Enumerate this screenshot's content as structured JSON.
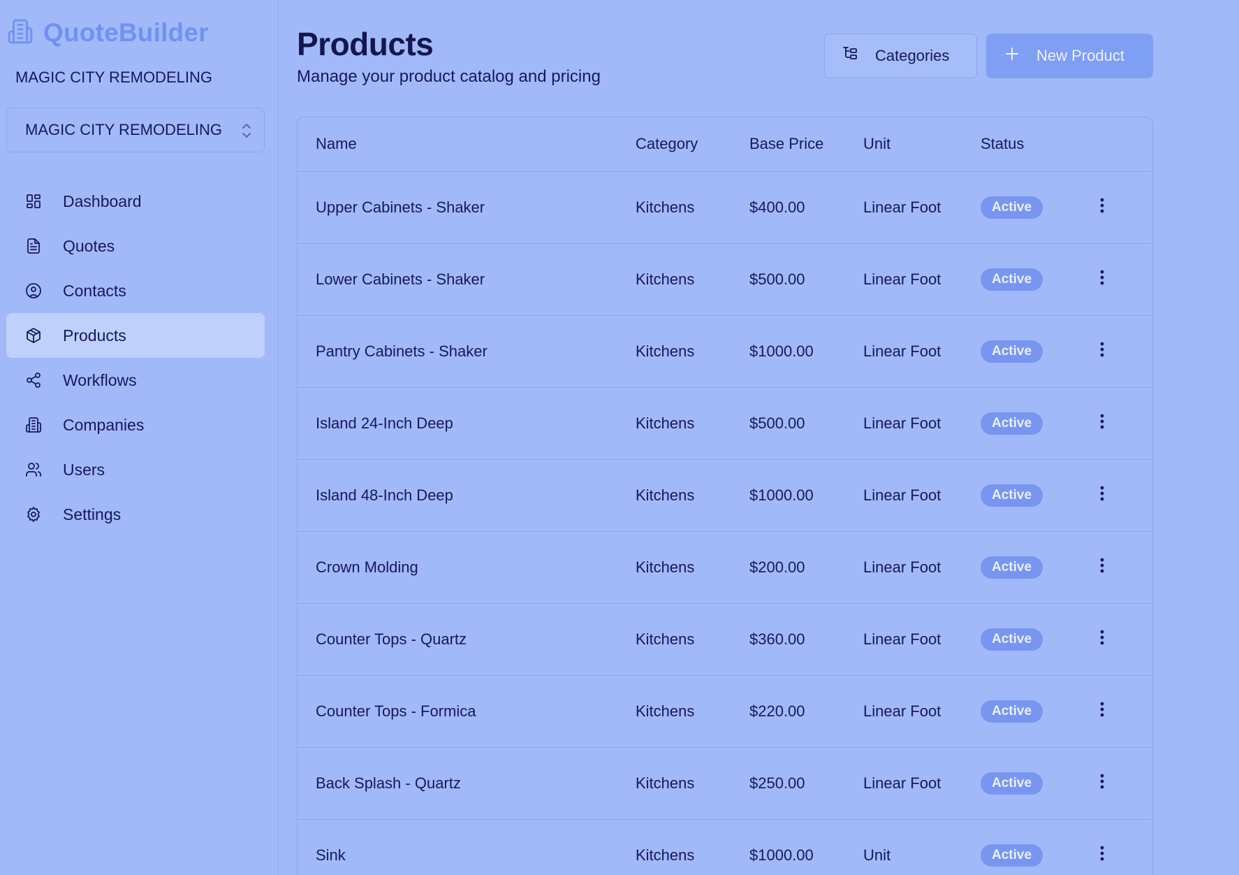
{
  "app": {
    "brand_name": "QuoteBuilder",
    "org_label": "MAGIC CITY REMODELING",
    "org_select_value": "MAGIC CITY REMODELING"
  },
  "sidebar": {
    "items": [
      {
        "label": "Dashboard",
        "icon": "dashboard-icon",
        "active": false
      },
      {
        "label": "Quotes",
        "icon": "document-icon",
        "active": false
      },
      {
        "label": "Contacts",
        "icon": "user-circle-icon",
        "active": false
      },
      {
        "label": "Products",
        "icon": "box-icon",
        "active": true
      },
      {
        "label": "Workflows",
        "icon": "share-icon",
        "active": false
      },
      {
        "label": "Companies",
        "icon": "building-icon",
        "active": false
      },
      {
        "label": "Users",
        "icon": "users-icon",
        "active": false
      },
      {
        "label": "Settings",
        "icon": "gear-icon",
        "active": false
      }
    ]
  },
  "header": {
    "title": "Products",
    "subtitle": "Manage your product catalog and pricing",
    "categories_label": "Categories",
    "new_product_label": "New Product"
  },
  "table": {
    "columns": [
      "Name",
      "Category",
      "Base Price",
      "Unit",
      "Status"
    ],
    "rows": [
      {
        "name": "Upper Cabinets - Shaker",
        "category": "Kitchens",
        "price": "$400.00",
        "unit": "Linear Foot",
        "status": "Active"
      },
      {
        "name": "Lower Cabinets - Shaker",
        "category": "Kitchens",
        "price": "$500.00",
        "unit": "Linear Foot",
        "status": "Active"
      },
      {
        "name": "Pantry Cabinets - Shaker",
        "category": "Kitchens",
        "price": "$1000.00",
        "unit": "Linear Foot",
        "status": "Active"
      },
      {
        "name": "Island 24-Inch Deep",
        "category": "Kitchens",
        "price": "$500.00",
        "unit": "Linear Foot",
        "status": "Active"
      },
      {
        "name": "Island 48-Inch Deep",
        "category": "Kitchens",
        "price": "$1000.00",
        "unit": "Linear Foot",
        "status": "Active"
      },
      {
        "name": "Crown Molding",
        "category": "Kitchens",
        "price": "$200.00",
        "unit": "Linear Foot",
        "status": "Active"
      },
      {
        "name": "Counter Tops - Quartz",
        "category": "Kitchens",
        "price": "$360.00",
        "unit": "Linear Foot",
        "status": "Active"
      },
      {
        "name": "Counter Tops - Formica",
        "category": "Kitchens",
        "price": "$220.00",
        "unit": "Linear Foot",
        "status": "Active"
      },
      {
        "name": "Back Splash - Quartz",
        "category": "Kitchens",
        "price": "$250.00",
        "unit": "Linear Foot",
        "status": "Active"
      },
      {
        "name": "Sink",
        "category": "Kitchens",
        "price": "$1000.00",
        "unit": "Unit",
        "status": "Active"
      }
    ]
  },
  "colors": {
    "background": "#a1b9f8",
    "brand": "#6f92f2",
    "active_nav": "#bfd0fb",
    "primary_button": "#7f9ff4",
    "badge": "#7896f0",
    "text": "#17185a"
  }
}
